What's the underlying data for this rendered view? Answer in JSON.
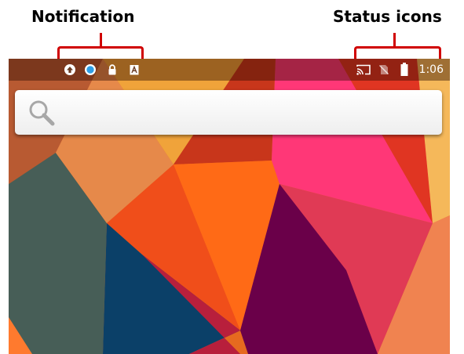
{
  "callouts": {
    "left_label": "Notification",
    "right_label": "Status icons",
    "bracket_color": "#d00000"
  },
  "status_bar": {
    "notification_icons": [
      "upload-icon",
      "sync-icon",
      "lock-icon",
      "keyboard-input-icon"
    ],
    "status_icons": [
      "cast-icon",
      "no-sim-icon",
      "battery-icon"
    ],
    "time": "1:06"
  },
  "search": {
    "icon": "search-icon"
  },
  "wallpaper": {
    "style": "polygon-material"
  }
}
